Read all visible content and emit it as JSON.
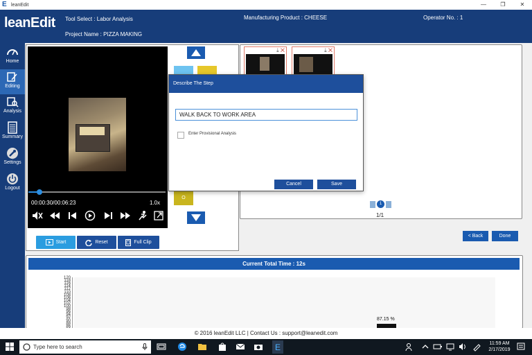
{
  "window": {
    "title": "leanEdit",
    "controls": [
      "—",
      "❐",
      "✕"
    ]
  },
  "header": {
    "logo": "leanEdit",
    "tool_select": "Tool Select : Labor Analysis",
    "project": "Project Name : PIZZA MAKING",
    "product": "Manufacturing Product : CHEESE",
    "operator": "Operator No. : 1"
  },
  "sidebar": {
    "items": [
      {
        "label": "Home",
        "icon": "speedometer-icon"
      },
      {
        "label": "Editing",
        "icon": "edit-icon"
      },
      {
        "label": "Analysis",
        "icon": "analysis-icon"
      },
      {
        "label": "Summary",
        "icon": "document-icon"
      },
      {
        "label": "Settings",
        "icon": "wrench-icon"
      },
      {
        "label": "Logout",
        "icon": "power-icon"
      }
    ],
    "active": "Editing"
  },
  "video": {
    "time": "00:00:30/00:06:23",
    "speed": "1.0x",
    "progress": 0.08
  },
  "controls": {
    "start": "Start",
    "reset": "Reset",
    "full_clip": "Full Clip"
  },
  "side_buttons": {
    "o_label": "O"
  },
  "clips": {
    "page_current": "1",
    "page_text": "1/1",
    "back": "< Back",
    "done": "Done"
  },
  "chart": {
    "header": "Current Total Time : 12s"
  },
  "chart_data": {
    "type": "bar",
    "y_ticks": [
      "120",
      "118",
      "116",
      "114",
      "112",
      "110",
      "108",
      "106",
      "104",
      "102",
      "100",
      "98",
      "96",
      "94",
      "92",
      "90",
      "88",
      "86",
      "84"
    ],
    "data_label": "87.15 %",
    "values": [
      87.15
    ]
  },
  "modal": {
    "title": "Describe The Step",
    "input_value": "WALK BACK TO WORK AREA",
    "checkbox_label": "Enter Provisional Analysis",
    "cancel": "Cancel",
    "save": "Save"
  },
  "footer": "© 2016 leanEdit LLC | Contact Us : support@leanedit.com",
  "taskbar": {
    "search_placeholder": "Type here to search",
    "time": "11:59 AM",
    "date": "2/17/2019"
  },
  "colors": {
    "brand": "#173d7a",
    "accent": "#1a5bb0",
    "light_accent": "#2b9de0"
  }
}
